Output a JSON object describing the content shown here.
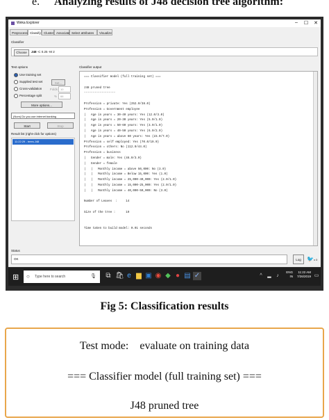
{
  "heading": {
    "letter": "e.",
    "title": "Analyzing results of J48 decision tree algorithm:"
  },
  "window": {
    "title": "Weka Explorer",
    "controls": [
      "–",
      "☐",
      "✕"
    ]
  },
  "tabs": [
    "Preprocess",
    "Classify",
    "Cluster",
    "Associate",
    "Select attributes",
    "Visualize"
  ],
  "active_tab": "Classify",
  "classifier": {
    "section_label": "Classifier",
    "choose_label": "Choose",
    "name": "J48",
    "options": "-C 0.25 -M 2"
  },
  "test_options": {
    "label": "Test options",
    "use_training_set": "Use training set",
    "supplied_test_set": "Supplied test set",
    "set_label": "Set...",
    "cross_validation": "Cross-validation",
    "folds_label": "Folds",
    "folds_value": "10",
    "percentage_split": "Percentage split",
    "pct_symbol": "%",
    "pct_value": "66",
    "more_options": "More options..."
  },
  "class_select": "(Nom) Do you use internet banking",
  "start_label": "Start",
  "stop_label": "Stop",
  "result_list": {
    "label": "Result list (right-click for options)",
    "items": [
      "11:22:29 - trees.J48"
    ]
  },
  "output": {
    "label": "Classifier output",
    "lines": [
      "=== Classifier model (full training set) ===",
      "",
      "J48 pruned tree",
      "------------------",
      "",
      "Profession = private: Yes (252.0/38.0)",
      "Profession = Government employee",
      "|   Age in years = 30-40 years: Yes (12.0/3.0)",
      "|   Age in years = 20-30 years: Yes (5.0/1.0)",
      "|   Age in years = 50-60 years: Yes (3.0/1.0)",
      "|   Age in years = 40-50 years: Yes (6.0/2.0)",
      "|   Age in years = above 60 years: Yes (23.0/7.0)",
      "Profession = self employed: Yes (70.0/19.0)",
      "Profession = others: No (112.0/44.0)",
      "Profession = business",
      "|   Gender = male: Yes (46.0/3.0)",
      "|   Gender = female",
      "|   |   Monthly income = above 50,000: No (3.0)",
      "|   |   Monthly income = Below 15,000: Yes (1.0)",
      "|   |   Monthly income = 25,000-40,000: Yes (2.0/1.0)",
      "|   |   Monthly income = 15,000-25,000: Yes (2.0/1.0)",
      "|   |   Monthly income = 40,000-50,000: No (3.0)",
      "",
      "Number of Leaves  :     14",
      "",
      "Size of the tree :      19",
      "",
      "",
      "Time taken to build model: 0.01 seconds"
    ]
  },
  "status": {
    "label": "Status",
    "text": "OK",
    "log_label": "Log",
    "count": "x 0"
  },
  "taskbar": {
    "search_placeholder": "Type here to search",
    "lang": "ENG",
    "region": "IN",
    "time": "11:22 AM",
    "date": "7/26/2019"
  },
  "caption": "Fig 5: Classification results",
  "box": {
    "test_mode_label": "Test mode:",
    "test_mode_value": "evaluate on training data",
    "model_header": "=== Classifier model (full training set) ===",
    "tree_title": "J48 pruned tree"
  }
}
